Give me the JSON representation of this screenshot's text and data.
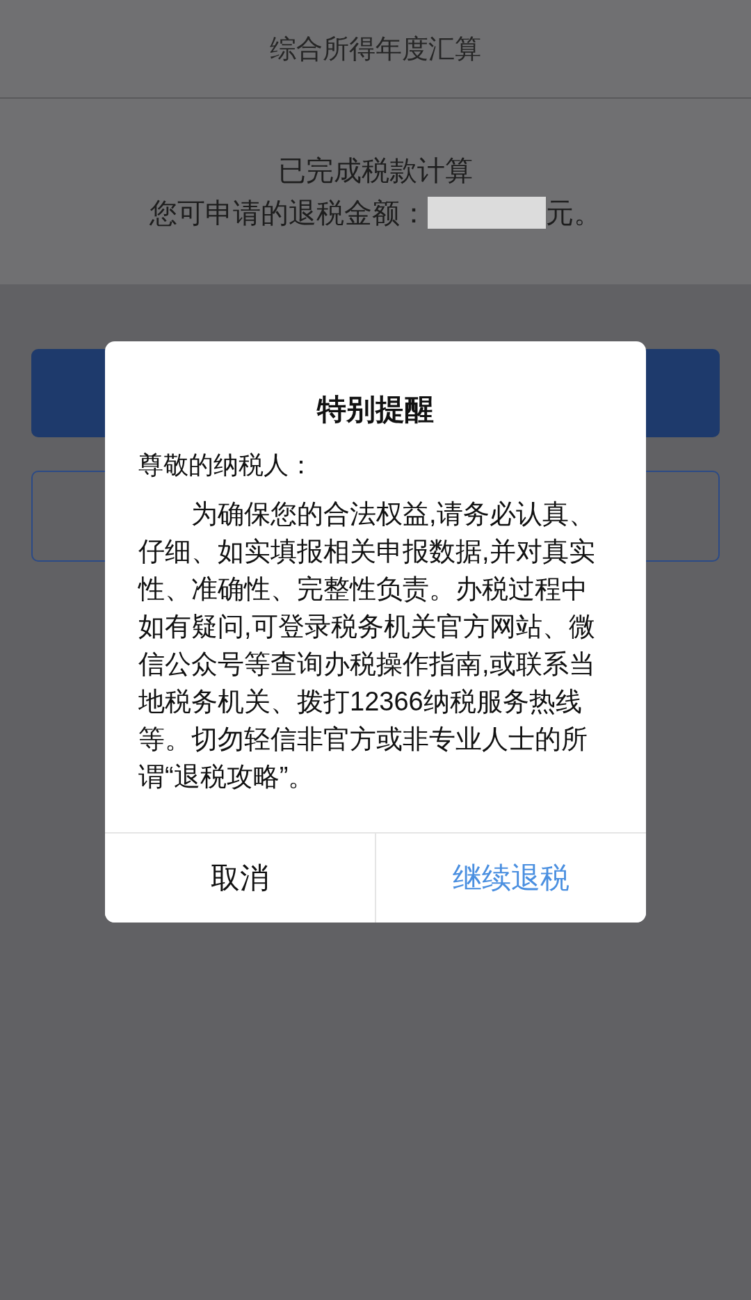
{
  "header": {
    "title": "综合所得年度汇算"
  },
  "summary": {
    "status": "已完成税款计算",
    "refund_label": "您可申请的退税金额：",
    "refund_suffix": "元。"
  },
  "dialog": {
    "title": "特别提醒",
    "salutation": "尊敬的纳税人：",
    "body": "为确保您的合法权益,请务必认真、仔细、如实填报相关申报数据,并对真实性、准确性、完整性负责。办税过程中如有疑问,可登录税务机关官方网站、微信公众号等查询办税操作指南,或联系当地税务机关、拨打12366纳税服务热线等。切勿轻信非官方或非专业人士的所谓“退税攻略”。",
    "buttons": [
      {
        "label": "取消",
        "kind": "cancel"
      },
      {
        "label": "继续退税",
        "kind": "confirm"
      }
    ]
  }
}
